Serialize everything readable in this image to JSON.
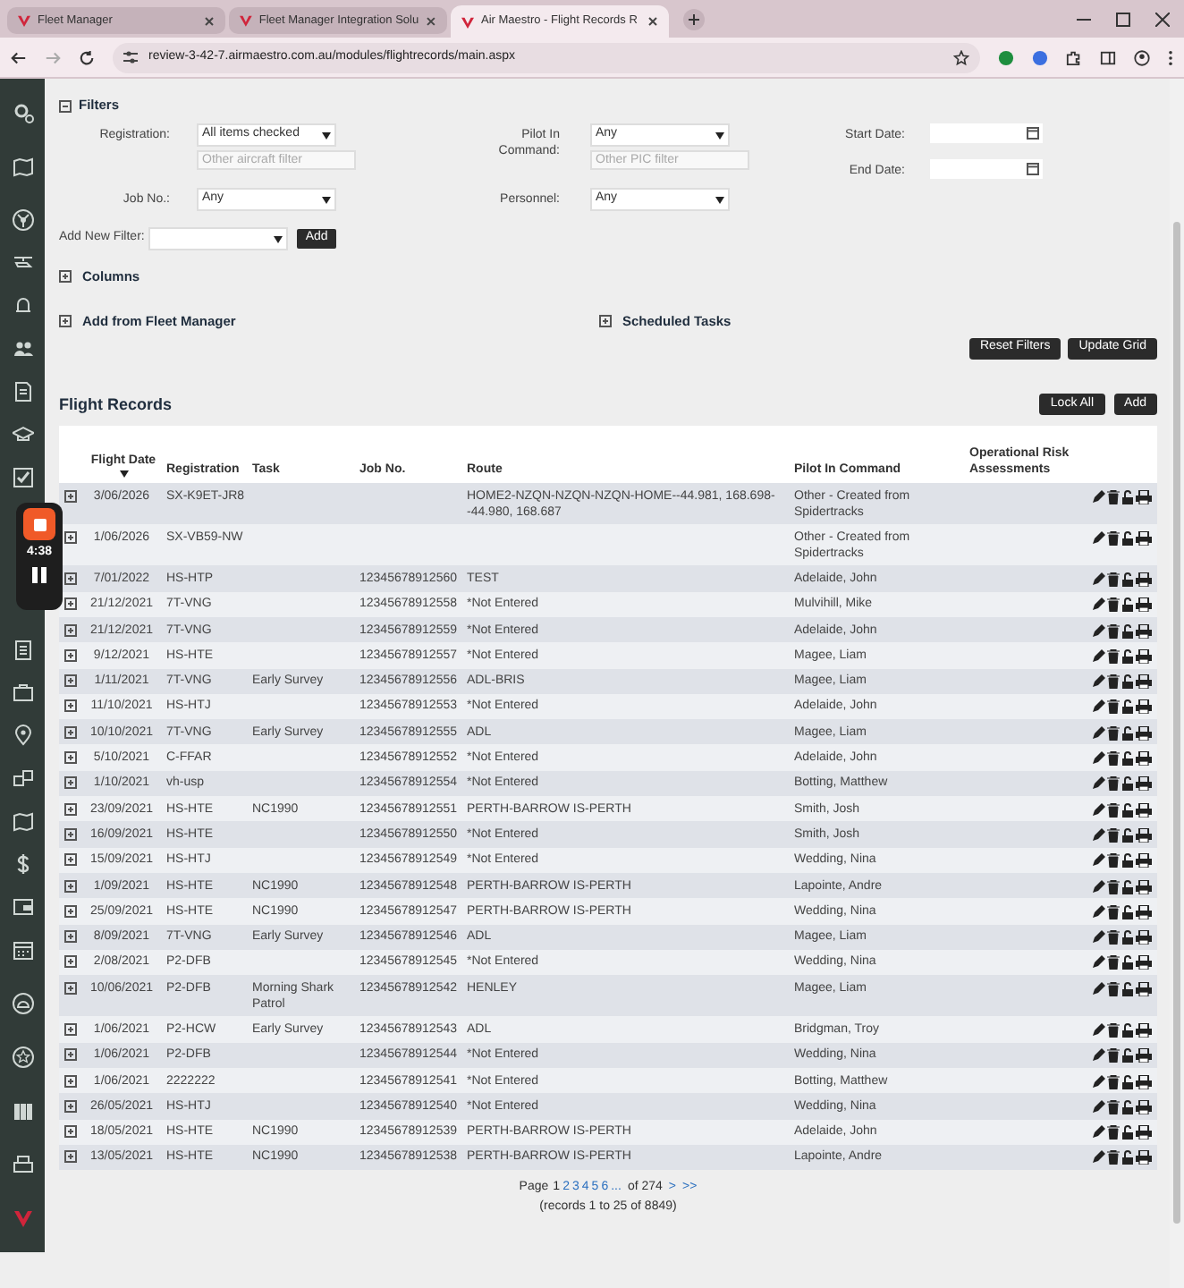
{
  "browser": {
    "tabs": [
      {
        "title": "Fleet Manager",
        "selected": false
      },
      {
        "title": "Fleet Manager Integration Solu",
        "selected": false
      },
      {
        "title": "Air Maestro - Flight Records R",
        "selected": true
      }
    ],
    "url": "review-3-42-7.airmaestro.com.au/modules/flightrecords/main.aspx"
  },
  "filters": {
    "title": "Filters",
    "expanded": true,
    "registration": {
      "label": "Registration:",
      "value": "All items checked",
      "placeholder": "Other aircraft filter"
    },
    "pilot": {
      "label": "Pilot In Command:",
      "value": "Any",
      "placeholder": "Other PIC filter"
    },
    "start_date": {
      "label": "Start Date:"
    },
    "end_date": {
      "label": "End Date:"
    },
    "job_no": {
      "label": "Job No.:",
      "value": "Any"
    },
    "personnel": {
      "label": "Personnel:",
      "value": "Any"
    },
    "add_new_filter": {
      "label": "Add New Filter:",
      "button": "Add"
    }
  },
  "sections": [
    {
      "title": "Columns",
      "expanded": false
    },
    {
      "title": "Add from Fleet Manager",
      "expanded": false
    },
    {
      "title": "Scheduled Tasks",
      "expanded": false
    }
  ],
  "filter_buttons": [
    "Reset Filters",
    "Update Grid"
  ],
  "flight_records": {
    "title": "Flight Records",
    "buttons": [
      "Lock All",
      "Add"
    ],
    "columns": [
      "Flight Date",
      "Registration",
      "Task",
      "Job No.",
      "Route",
      "Pilot In Command",
      "Operational Risk Assessments"
    ],
    "rows": [
      [
        "3/06/2026",
        "SX-K9ET-JR8",
        "",
        "",
        "HOME2-NZQN-NZQN-NZQN-HOME--44.981, 168.698--44.980, 168.687",
        "Other - Created from Spidertracks"
      ],
      [
        "1/06/2026",
        "SX-VB59-NW",
        "",
        "",
        "",
        "Other - Created from Spidertracks"
      ],
      [
        "7/01/2022",
        "HS-HTP",
        "",
        "12345678912560",
        "TEST",
        "Adelaide, John"
      ],
      [
        "21/12/2021",
        "7T-VNG",
        "",
        "12345678912558",
        "*Not Entered",
        "Mulvihill, Mike"
      ],
      [
        "21/12/2021",
        "7T-VNG",
        "",
        "12345678912559",
        "*Not Entered",
        "Adelaide, John"
      ],
      [
        "9/12/2021",
        "HS-HTE",
        "",
        "12345678912557",
        "*Not Entered",
        "Magee, Liam"
      ],
      [
        "1/11/2021",
        "7T-VNG",
        "Early Survey",
        "12345678912556",
        "ADL-BRIS",
        "Magee, Liam"
      ],
      [
        "11/10/2021",
        "HS-HTJ",
        "",
        "12345678912553",
        "*Not Entered",
        "Adelaide, John"
      ],
      [
        "10/10/2021",
        "7T-VNG",
        "Early Survey",
        "12345678912555",
        "ADL",
        "Magee, Liam"
      ],
      [
        "5/10/2021",
        "C-FFAR",
        "",
        "12345678912552",
        "*Not Entered",
        "Adelaide, John"
      ],
      [
        "1/10/2021",
        "vh-usp",
        "",
        "12345678912554",
        "*Not Entered",
        "Botting, Matthew"
      ],
      [
        "23/09/2021",
        "HS-HTE",
        "NC1990",
        "12345678912551",
        "PERTH-BARROW IS-PERTH",
        "Smith, Josh"
      ],
      [
        "16/09/2021",
        "HS-HTE",
        "",
        "12345678912550",
        "*Not Entered",
        "Smith, Josh"
      ],
      [
        "15/09/2021",
        "HS-HTJ",
        "",
        "12345678912549",
        "*Not Entered",
        "Wedding, Nina"
      ],
      [
        "1/09/2021",
        "HS-HTE",
        "NC1990",
        "12345678912548",
        "PERTH-BARROW IS-PERTH",
        "Lapointe, Andre"
      ],
      [
        "25/09/2021",
        "HS-HTE",
        "NC1990",
        "12345678912547",
        "PERTH-BARROW IS-PERTH",
        "Wedding, Nina"
      ],
      [
        "8/09/2021",
        "7T-VNG",
        "Early Survey",
        "12345678912546",
        "ADL",
        "Magee, Liam"
      ],
      [
        "2/08/2021",
        "P2-DFB",
        "",
        "12345678912545",
        "*Not Entered",
        "Wedding, Nina"
      ],
      [
        "10/06/2021",
        "P2-DFB",
        "Morning Shark Patrol",
        "12345678912542",
        "HENLEY",
        "Magee, Liam"
      ],
      [
        "1/06/2021",
        "P2-HCW",
        "Early Survey",
        "12345678912543",
        "ADL",
        "Bridgman, Troy"
      ],
      [
        "1/06/2021",
        "P2-DFB",
        "",
        "12345678912544",
        "*Not Entered",
        "Wedding, Nina"
      ],
      [
        "1/06/2021",
        "2222222",
        "",
        "12345678912541",
        "*Not Entered",
        "Botting, Matthew"
      ],
      [
        "26/05/2021",
        "HS-HTJ",
        "",
        "12345678912540",
        "*Not Entered",
        "Wedding, Nina"
      ],
      [
        "18/05/2021",
        "HS-HTE",
        "NC1990",
        "12345678912539",
        "PERTH-BARROW IS-PERTH",
        "Adelaide, John"
      ],
      [
        "13/05/2021",
        "HS-HTE",
        "NC1990",
        "12345678912538",
        "PERTH-BARROW IS-PERTH",
        "Lapointe, Andre"
      ]
    ]
  },
  "pagination": {
    "label": "Page",
    "pages": [
      {
        "label": "1",
        "selected": true
      },
      {
        "label": "2",
        "selected": false
      },
      {
        "label": "3",
        "selected": false
      },
      {
        "label": "4",
        "selected": false
      },
      {
        "label": "5",
        "selected": false
      },
      {
        "label": "6",
        "selected": false
      },
      {
        "label": "...",
        "selected": false
      }
    ],
    "of": "of 274",
    "next": ">",
    "last": ">>",
    "summary": "(records 1 to 25 of 8849)"
  },
  "recorder": {
    "time": "4:38"
  }
}
